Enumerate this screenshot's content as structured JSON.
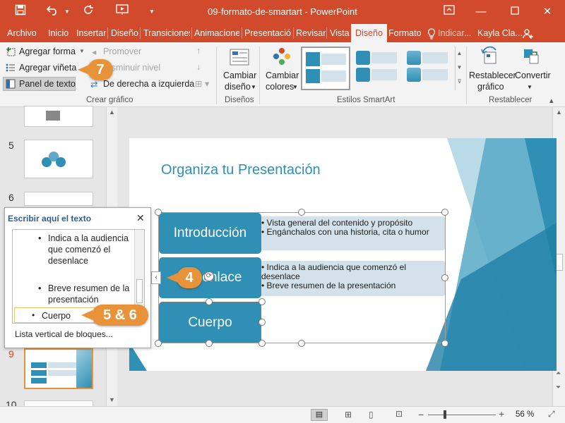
{
  "window": {
    "title": "09-formato-de-smartart - PowerPoint",
    "minimize_icon": "minimize-icon",
    "maximize_icon": "maximize-icon",
    "close_icon": "close-icon"
  },
  "menu": {
    "tabs": [
      "Archivo",
      "Inicio",
      "Insertar",
      "Diseño",
      "Transiciones",
      "Animaciones",
      "Presentació",
      "Revisar",
      "Vista",
      "Diseño",
      "Formato"
    ],
    "active_tab": "Diseño",
    "tell_me": "Indicar...",
    "user": "Kayla Cla..."
  },
  "ribbon": {
    "crear": {
      "agregar_forma": "Agregar forma",
      "agregar_vineta": "Agregar viñeta",
      "panel_texto": "Panel de texto",
      "promover": "Promover",
      "disminuir": "Disminuir nivel",
      "derecha_izq": "De derecha a izquierda",
      "label": "Crear gráfico"
    },
    "disenos": {
      "cambiar_diseno": "Cambiar",
      "cambiar_diseno_2": "diseño",
      "label": "Diseños"
    },
    "estilos": {
      "cambiar_colores": "Cambiar",
      "cambiar_colores_2": "colores",
      "label": "Estilos SmartArt"
    },
    "restablecer": {
      "restablecer_grafico": "Restablecer",
      "restablecer_grafico_2": "gráfico",
      "convertir": "Convertir",
      "label": "Restablecer"
    }
  },
  "thumbnails": {
    "numbers": [
      "5",
      "6",
      "9",
      "10"
    ]
  },
  "text_pane": {
    "title": "Escribir aquí el texto",
    "bullets": [
      "Indica a la audiencia que comenzó el desenlace",
      "Breve resumen de la presentación"
    ],
    "current_item": "Cuerpo",
    "footer": "Lista vertical de bloques..."
  },
  "slide": {
    "title": "Organiza tu Presentación",
    "blocks": [
      {
        "label": "Introducción",
        "bullets": [
          "Vista general del contenido y propósito",
          "Engánchalos con una historia, cita o humor"
        ]
      },
      {
        "label": "Desenlace",
        "bullets": [
          "Indica a la audiencia que comenzó el desenlace",
          "Breve resumen de la presentación"
        ]
      },
      {
        "label": "Cuerpo",
        "bullets": []
      }
    ]
  },
  "callouts": {
    "step7": "7",
    "step4": "4",
    "step56": "5 & 6"
  },
  "status": {
    "zoom": "56 %"
  },
  "colors": {
    "accent": "#d04a2b",
    "smartart_blue": "#2f8fb4",
    "callout_orange": "#e8923a"
  }
}
